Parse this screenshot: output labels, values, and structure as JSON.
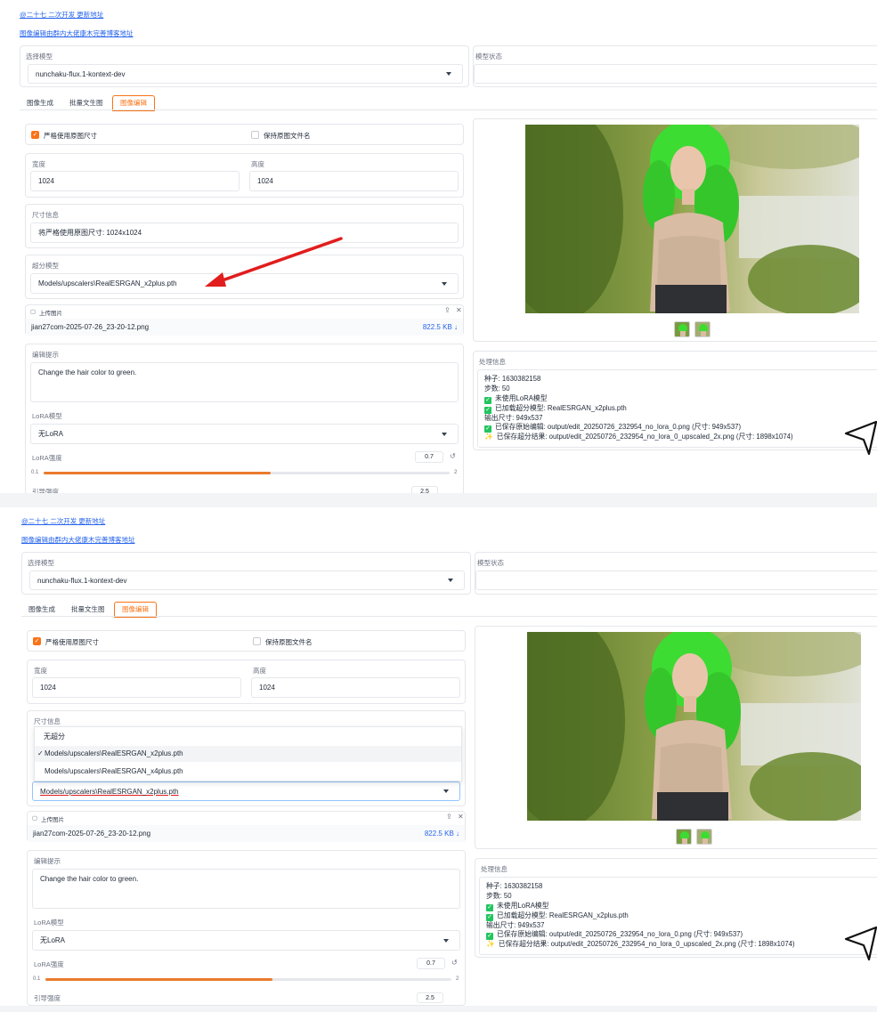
{
  "top_links": {
    "link1": "@二十七 二次开发 更新地址",
    "link2": "图像编辑由群内大佬康木完善博客地址"
  },
  "model": {
    "label": "选择模型",
    "value": "nunchaku-flux.1-kontext-dev",
    "status_label": "模型状态"
  },
  "tabs": [
    "图像生成",
    "批量文生图",
    "图像编辑"
  ],
  "options": {
    "keep_size_label": "严格使用原图尺寸",
    "keep_name_label": "保持原图文件名"
  },
  "size": {
    "width_label": "宽度",
    "width_value": "1024",
    "height_label": "高度",
    "height_value": "1024",
    "info_label": "尺寸信息",
    "info_value": "将严格使用原图尺寸: 1024x1024"
  },
  "upscale": {
    "label": "超分模型",
    "value": "Models/upscalers\\RealESRGAN_x2plus.pth",
    "options": [
      "无超分",
      "Models/upscalers\\RealESRGAN_x2plus.pth",
      "Models/upscalers\\RealESRGAN_x4plus.pth"
    ]
  },
  "upload": {
    "label": "上传图片",
    "filename": "jian27com-2025-07-26_23-20-12.png",
    "size": "822.5 KB ↓"
  },
  "prompt": {
    "label": "编辑提示",
    "value": "Change the hair color to green."
  },
  "lora": {
    "label": "LoRA模型",
    "value": "无LoRA",
    "strength_label": "LoRA强度",
    "strength_value": "0.7",
    "strength_fraction": 0.56,
    "min": "0.1",
    "max": "2",
    "guidance_label": "引导强度",
    "guidance_value": "2.5"
  },
  "processing": {
    "label": "处理信息",
    "seed": "种子: 1630382158",
    "steps": "步数: 50",
    "lora_line": "未使用LoRA模型",
    "upscaler_line": "已加载超分模型: RealESRGAN_x2plus.pth",
    "outsize": "输出尺寸: 949x537",
    "saved_line": "已保存原始编辑: output/edit_20250726_232954_no_lora_0.png (尺寸: 949x537)",
    "upscaled_line": "已保存超分结果: output/edit_20250726_232954_no_lora_0_upscaled_2x.png (尺寸: 1898x1074)"
  },
  "colors": {
    "accent": "#f97316",
    "link": "#2563eb",
    "arrow": "#e11d1d",
    "hair": "#3ddc32"
  },
  "icons": [
    "upload-icon",
    "close-icon",
    "reset-icon",
    "check-icon",
    "sparkle-icon",
    "cursor-icon",
    "chevron-down-icon"
  ]
}
